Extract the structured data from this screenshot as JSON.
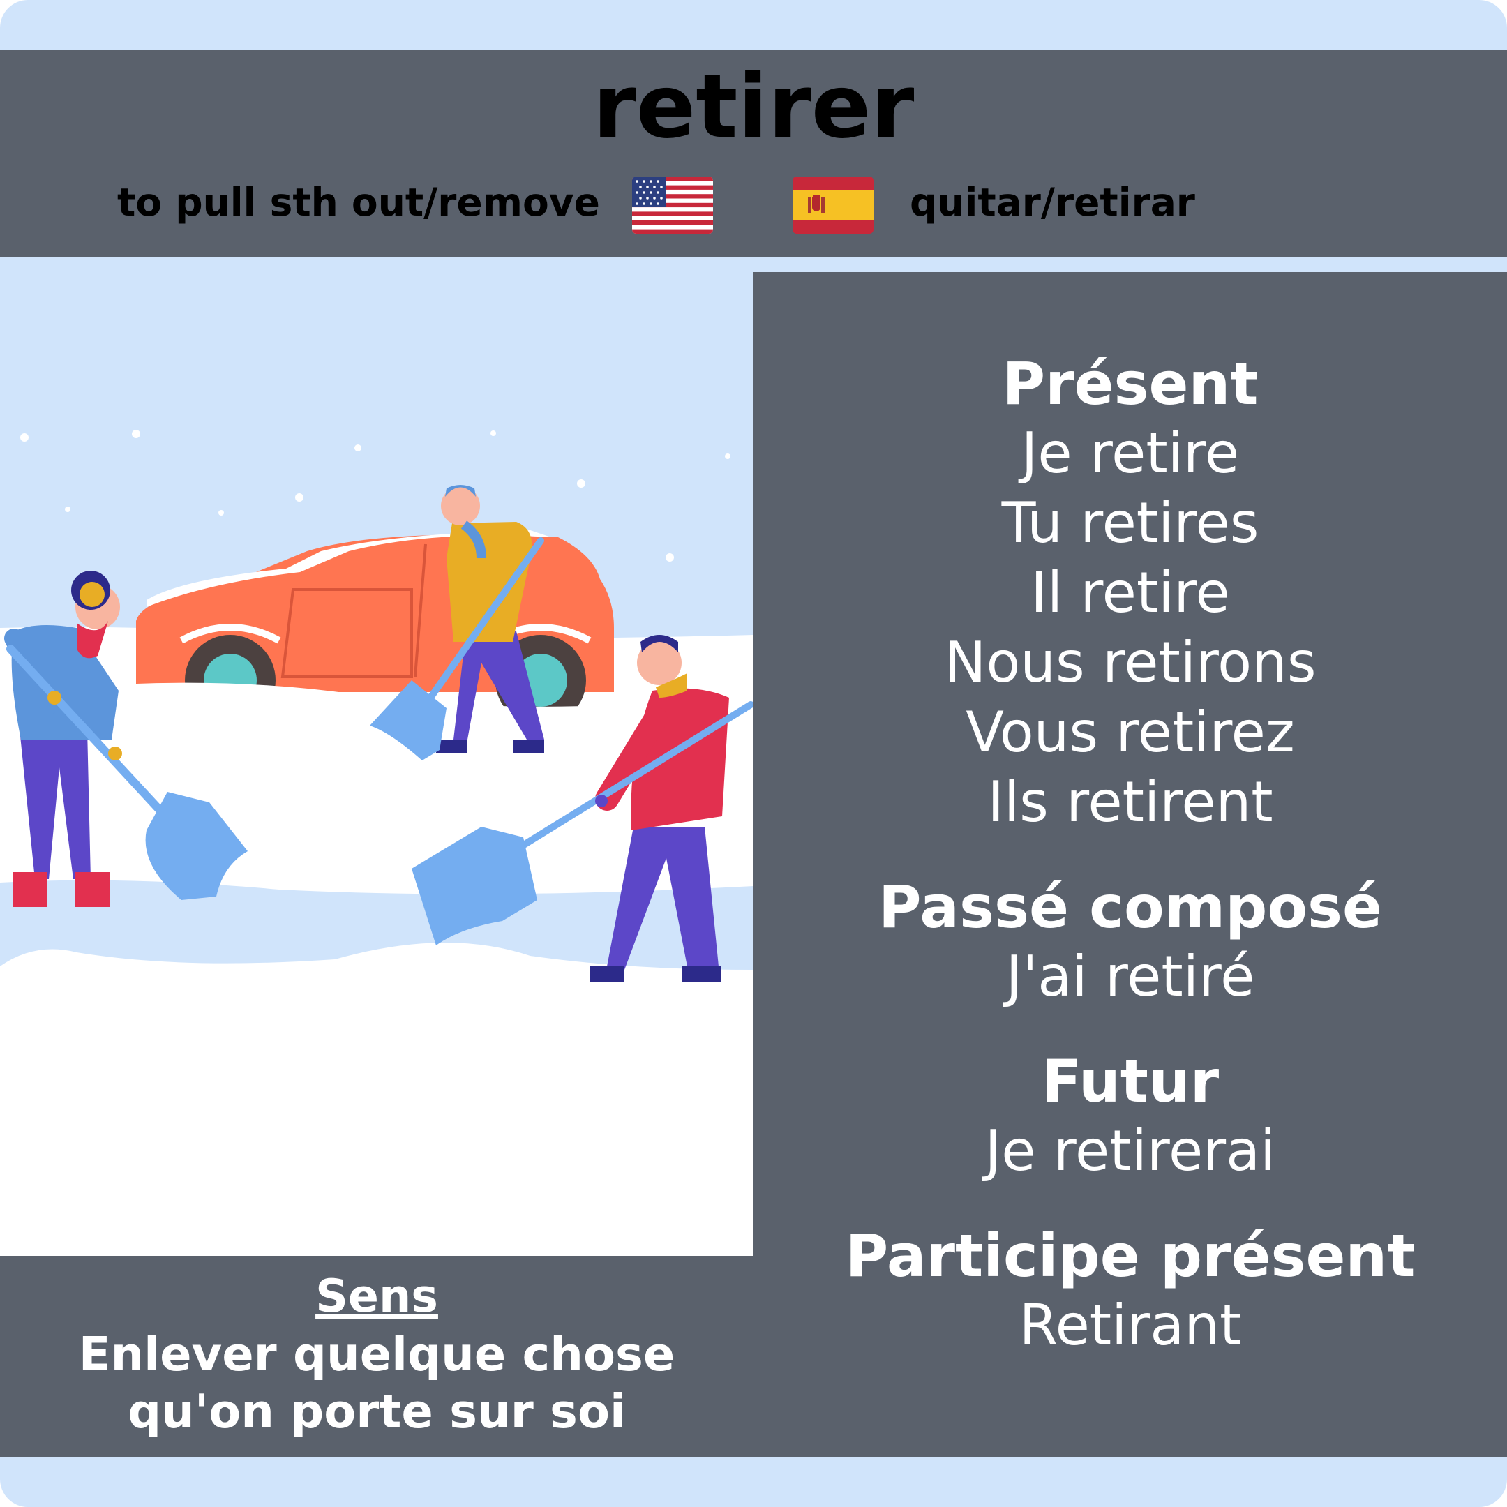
{
  "header": {
    "verb": "retirer",
    "english": "to pull sth out/remove",
    "spanish": "quitar/retirar",
    "icons": [
      "us-flag-icon",
      "spain-flag-icon"
    ]
  },
  "conjugation": {
    "present": {
      "label": "Présent",
      "forms": [
        "Je retire",
        "Tu retires",
        "Il retire",
        "Nous retirons",
        "Vous retirez",
        "Ils retirent"
      ]
    },
    "passe_compose": {
      "label": "Passé composé",
      "form": "J'ai retiré"
    },
    "futur": {
      "label": "Futur",
      "form": "Je retirerai"
    },
    "participe_present": {
      "label": "Participe présent",
      "form": "Retirant"
    }
  },
  "sens": {
    "title": "Sens",
    "lines": [
      "Enlever quelque chose",
      "qu'on porte sur soi"
    ]
  },
  "colors": {
    "panel": "#5a616c",
    "background": "#d0e4fb",
    "car": "#ff7551",
    "shovel": "#74adf0",
    "pants": "#5c47c8",
    "red_jacket": "#e2304f",
    "yellow_jacket": "#e8ad25",
    "blue_jacket": "#5c95db"
  }
}
